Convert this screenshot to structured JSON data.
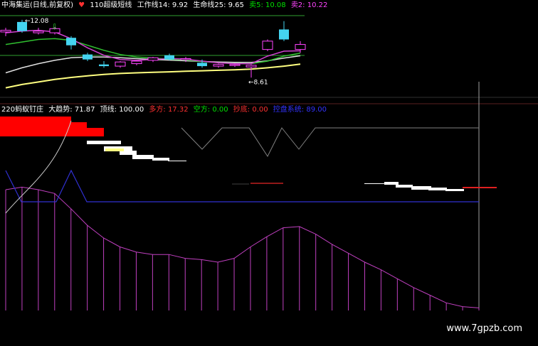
{
  "header_top": [
    {
      "text": "中海集运(日线,前复权)",
      "color": "#ffffff"
    },
    {
      "text": "♥",
      "color": "#ff3030"
    },
    {
      "text": "110超级短线",
      "color": "#ffffff"
    },
    {
      "text": "工作线14: 9.92",
      "color": "#ffffff"
    },
    {
      "text": "生命线25: 9.65",
      "color": "#ffffff"
    },
    {
      "text": "卖5: 10.08",
      "color": "#00e000"
    },
    {
      "text": "卖2: 10.22",
      "color": "#ff44ff"
    }
  ],
  "header_bottom": [
    {
      "text": "220蚂蚁钉庄",
      "color": "#ffffff"
    },
    {
      "text": "大趋势: 71.87",
      "color": "#ffffff"
    },
    {
      "text": "顶线: 100.00",
      "color": "#ffffff"
    },
    {
      "text": "多方: 17.32",
      "color": "#ff3030"
    },
    {
      "text": "空方: 0.00",
      "color": "#00e000"
    },
    {
      "text": "抄底: 0.00",
      "color": "#ff3030"
    },
    {
      "text": "控盘系统: 89.00",
      "color": "#3333ff"
    }
  ],
  "watermark": "www.7gpzb.com",
  "colors": {
    "background": "#000000",
    "up_candle": "#ff44ff",
    "down_candle": "#44d4f0",
    "ma_green": "#30c030",
    "ma_white": "#e0e0e0",
    "ma_yellow": "#ffff80",
    "ma_magenta": "#d040d0",
    "trend_bar": "#c040c0",
    "control_line": "#3030d0",
    "red_block": "#ff0000",
    "white_block": "#ffffff",
    "grey_line": "#808080",
    "crosshair": "#a0a0a0"
  },
  "chart_data": [
    {
      "type": "candlestick",
      "title": "中海集运(日线,前复权)",
      "annotations": [
        {
          "label": "12.08",
          "type": "high"
        },
        {
          "label": "8.61",
          "type": "low"
        }
      ],
      "ohlc": [
        {
          "o": 11.35,
          "h": 11.6,
          "l": 11.1,
          "c": 11.45,
          "dir": "up"
        },
        {
          "o": 11.95,
          "h": 12.08,
          "l": 11.3,
          "c": 11.4,
          "dir": "down"
        },
        {
          "o": 11.4,
          "h": 11.6,
          "l": 11.2,
          "c": 11.3,
          "dir": "up"
        },
        {
          "o": 11.55,
          "h": 11.65,
          "l": 11.2,
          "c": 11.3,
          "dir": "up"
        },
        {
          "o": 11.0,
          "h": 11.1,
          "l": 10.3,
          "c": 10.55,
          "dir": "down"
        },
        {
          "o": 10.0,
          "h": 10.1,
          "l": 9.6,
          "c": 9.7,
          "dir": "down"
        },
        {
          "o": 9.4,
          "h": 9.6,
          "l": 9.2,
          "c": 9.3,
          "dir": "down"
        },
        {
          "o": 9.3,
          "h": 9.6,
          "l": 9.2,
          "c": 9.55,
          "dir": "up"
        },
        {
          "o": 9.45,
          "h": 9.65,
          "l": 9.35,
          "c": 9.6,
          "dir": "up"
        },
        {
          "o": 9.65,
          "h": 9.85,
          "l": 9.55,
          "c": 9.8,
          "dir": "up"
        },
        {
          "o": 9.95,
          "h": 10.05,
          "l": 9.65,
          "c": 9.7,
          "dir": "down"
        },
        {
          "o": 9.7,
          "h": 9.85,
          "l": 9.55,
          "c": 9.75,
          "dir": "up"
        },
        {
          "o": 9.5,
          "h": 9.7,
          "l": 9.2,
          "c": 9.3,
          "dir": "down"
        },
        {
          "o": 9.3,
          "h": 9.45,
          "l": 9.2,
          "c": 9.4,
          "dir": "up"
        },
        {
          "o": 9.35,
          "h": 9.45,
          "l": 9.25,
          "c": 9.4,
          "dir": "up"
        },
        {
          "o": 9.25,
          "h": 9.4,
          "l": 8.61,
          "c": 9.35,
          "dir": "up"
        },
        {
          "o": 10.3,
          "h": 10.9,
          "l": 10.2,
          "c": 10.8,
          "dir": "up"
        },
        {
          "o": 11.5,
          "h": 12.0,
          "l": 10.8,
          "c": 10.9,
          "dir": "down"
        },
        {
          "o": 10.3,
          "h": 10.8,
          "l": 10.1,
          "c": 10.6,
          "dir": "up"
        }
      ],
      "ma_yellow": [
        8.0,
        8.2,
        8.35,
        8.5,
        8.62,
        8.72,
        8.8,
        8.86,
        8.9,
        8.93,
        8.96,
        8.99,
        9.02,
        9.05,
        9.08,
        9.12,
        9.2,
        9.3,
        9.42
      ],
      "ma_white": [
        8.9,
        9.2,
        9.45,
        9.65,
        9.8,
        9.85,
        9.85,
        9.8,
        9.75,
        9.7,
        9.66,
        9.62,
        9.58,
        9.55,
        9.53,
        9.52,
        9.62,
        9.78,
        9.92
      ],
      "ma_green": [
        10.6,
        10.75,
        10.9,
        10.95,
        10.85,
        10.55,
        10.25,
        10.0,
        9.85,
        9.78,
        9.72,
        9.66,
        9.58,
        9.5,
        9.46,
        9.45,
        9.6,
        9.9,
        10.08
      ],
      "ma_magenta": [
        11.3,
        11.4,
        11.45,
        11.35,
        10.95,
        10.4,
        9.95,
        9.7,
        9.65,
        9.7,
        9.75,
        9.72,
        9.6,
        9.5,
        9.45,
        9.45,
        9.9,
        10.2,
        10.22
      ]
    },
    {
      "type": "bar",
      "title": "220蚂蚁钉庄",
      "series": [
        {
          "name": "大趋势",
          "values": [
            95,
            97,
            95,
            92,
            80,
            67,
            57,
            50,
            46,
            44,
            44,
            41,
            40,
            38,
            41,
            50,
            58,
            65,
            66,
            60,
            52,
            45,
            38,
            32,
            25,
            18,
            12,
            6,
            3,
            2
          ]
        },
        {
          "name": "控盘系统",
          "values": [
            89,
            89,
            89,
            89,
            89,
            89,
            89,
            89,
            89,
            89,
            89,
            89,
            89,
            89,
            89,
            89,
            89,
            89,
            89,
            89,
            89,
            89,
            89,
            89,
            89,
            89,
            89,
            89,
            89,
            89
          ]
        }
      ]
    }
  ]
}
